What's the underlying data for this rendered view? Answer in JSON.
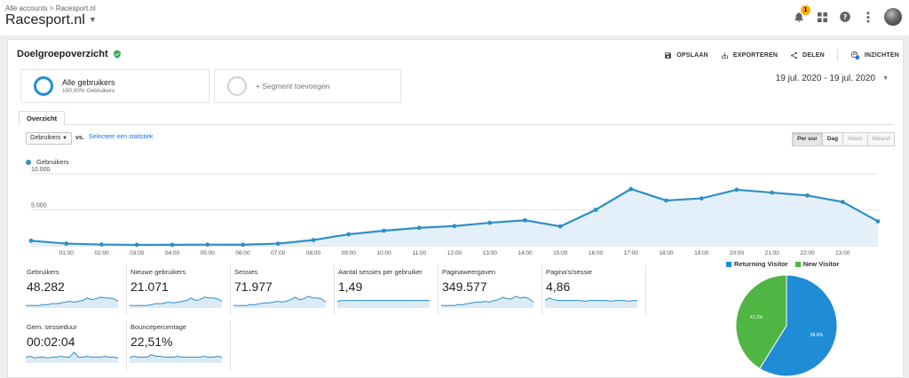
{
  "header": {
    "breadcrumb": "Alle accounts > Racesport.nl",
    "property": "Racesport.nl",
    "notification_count": "1"
  },
  "report": {
    "title": "Doelgroepoverzicht",
    "actions": [
      "OPSLAAN",
      "EXPORTEREN",
      "DELEN",
      "INZICHTEN"
    ]
  },
  "segments": {
    "active_title": "Alle gebruikers",
    "active_sub": "100,00% Gebruikers",
    "add_label": "+ Segment toevoegen"
  },
  "date_range": "19 jul. 2020 - 19 jul. 2020",
  "tab": "Overzicht",
  "controls": {
    "metric_select": "Gebruikers",
    "vs_label": "vs.",
    "pick_metric": "Selecteer een statistiek",
    "granularity": [
      "Per uur",
      "Dag",
      "Week",
      "Maand"
    ]
  },
  "colors": {
    "accent": "#2f8fc6",
    "returning": "#1f8dd6",
    "new": "#4fb543"
  },
  "chart_data": [
    {
      "type": "area",
      "legend": "top-left",
      "series": [
        {
          "name": "Gebruikers",
          "values": [
            700,
            300,
            180,
            130,
            140,
            160,
            150,
            300,
            800,
            1600,
            2100,
            2500,
            2750,
            3200,
            3550,
            2700,
            5000,
            7900,
            6300,
            6600,
            7800,
            7400,
            7000,
            6100,
            3400
          ]
        }
      ],
      "x": [
        "...",
        "01:00",
        "02:00",
        "03:00",
        "04:00",
        "05:00",
        "06:00",
        "07:00",
        "08:00",
        "09:00",
        "10:00",
        "11:00",
        "12:00",
        "13:00",
        "14:00",
        "15:00",
        "16:00",
        "17:00",
        "18:00",
        "19:00",
        "20:00",
        "21:00",
        "22:00",
        "23:00"
      ],
      "x_labels": [
        "01:00",
        "02:00",
        "03:00",
        "04:00",
        "05:00",
        "06:00",
        "07:00",
        "08:00",
        "09:00",
        "10:00",
        "11:00",
        "12:00",
        "13:00",
        "14:00",
        "15:00",
        "16:00",
        "17:00",
        "18:00",
        "19:00",
        "20:00",
        "21:00",
        "22:00",
        "23:00"
      ],
      "y_ticks": [
        "5.000",
        "10.000"
      ],
      "ylim": [
        0,
        10000
      ]
    },
    {
      "type": "pie",
      "legend": "top",
      "labels": [
        "Returning Visitor",
        "New Visitor"
      ],
      "values": [
        58.9,
        41.1
      ],
      "value_labels": [
        "58,9%",
        "41,1%"
      ]
    }
  ],
  "metrics": [
    {
      "name": "Gebruikers",
      "value": "48.282",
      "spark": [
        3,
        3,
        3,
        3,
        4,
        4,
        5,
        5,
        6,
        7,
        8,
        7,
        8,
        9,
        12,
        10,
        11,
        13,
        12,
        12,
        11,
        8
      ]
    },
    {
      "name": "Nieuwe gebruikers",
      "value": "21.071",
      "spark": [
        3,
        3,
        3,
        3,
        3,
        4,
        5,
        5,
        6,
        7,
        6,
        7,
        8,
        9,
        12,
        9,
        10,
        13,
        12,
        12,
        11,
        8
      ]
    },
    {
      "name": "Sessies",
      "value": "71.977",
      "spark": [
        3,
        3,
        3,
        3,
        4,
        4,
        5,
        6,
        6,
        7,
        8,
        7,
        8,
        10,
        13,
        10,
        11,
        14,
        12,
        12,
        11,
        7
      ]
    },
    {
      "name": "Aantal sessies per gebruiker",
      "value": "1,49",
      "spark": [
        8,
        9,
        9,
        9,
        9,
        9,
        9,
        9,
        9,
        9,
        9,
        9,
        9,
        9,
        9,
        9,
        9,
        9,
        9,
        9,
        9,
        9
      ]
    },
    {
      "name": "Paginaweergaven",
      "value": "349.577",
      "spark": [
        3,
        3,
        3,
        3,
        4,
        4,
        5,
        6,
        7,
        7,
        8,
        7,
        9,
        10,
        13,
        11,
        11,
        14,
        12,
        13,
        11,
        7
      ]
    },
    {
      "name": "Pagina's/sessie",
      "value": "4,86",
      "spark": [
        9,
        12,
        10,
        9,
        9,
        9,
        9,
        9,
        9,
        8,
        9,
        9,
        9,
        9,
        9,
        8,
        9,
        9,
        9,
        8,
        9,
        9
      ]
    },
    {
      "name": "Gem. sessieduur",
      "value": "00:02:04",
      "spark": [
        7,
        8,
        6,
        7,
        7,
        6,
        7,
        7,
        8,
        7,
        7,
        13,
        7,
        7,
        8,
        7,
        7,
        7,
        8,
        7,
        7,
        6
      ]
    },
    {
      "name": "Bouncepercentage",
      "value": "22,51%",
      "spark": [
        7,
        8,
        7,
        7,
        7,
        10,
        8,
        8,
        7,
        7,
        7,
        8,
        7,
        7,
        7,
        7,
        7,
        8,
        7,
        7,
        8,
        7
      ]
    }
  ]
}
